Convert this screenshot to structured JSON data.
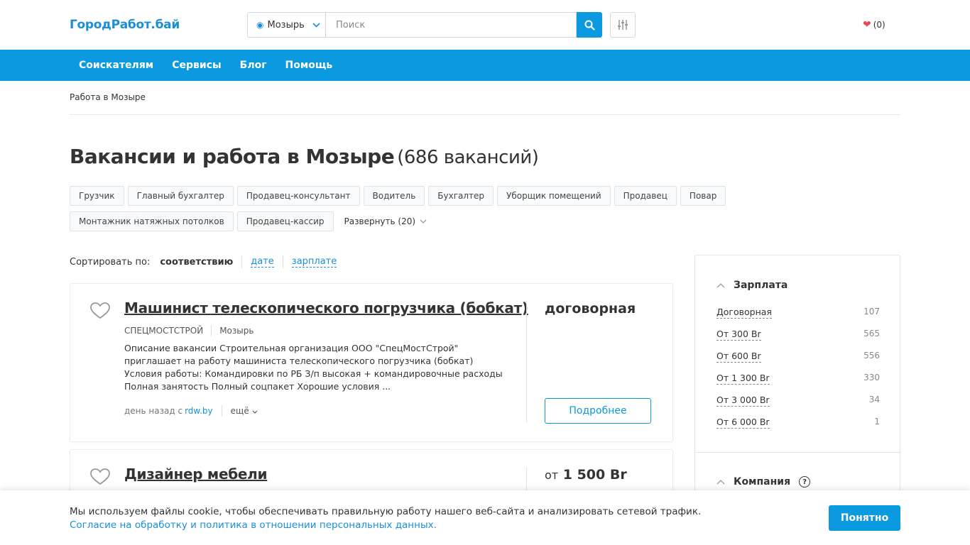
{
  "header": {
    "logo": "ГородРабот.бай",
    "city": "Мозырь",
    "search_placeholder": "Поиск",
    "favorites_count": "(0)"
  },
  "nav": {
    "items": [
      "Соискателям",
      "Сервисы",
      "Блог",
      "Помощь"
    ]
  },
  "breadcrumb": "Работа в Мозыре",
  "page": {
    "title": "Вакансии и работа в Мозыре",
    "count": "(686 вакансий)"
  },
  "tags": [
    "Грузчик",
    "Главный бухгалтер",
    "Продавец-консультант",
    "Водитель",
    "Бухгалтер",
    "Уборщик помещений",
    "Продавец",
    "Повар",
    "Монтажник натяжных потолков",
    "Продавец-кассир"
  ],
  "expand_label": "Развернуть (20)",
  "sort": {
    "label": "Сортировать по:",
    "active": "соответствию",
    "options": [
      "дате",
      "зарплате"
    ]
  },
  "vacancies": [
    {
      "title": "Машинист телескопического погрузчика (бобкат)",
      "company": "СПЕЦМОСТСТРОЙ",
      "city": "Мозырь",
      "description": "Описание вакансии Строительная организация ООО \"СпецМостСтрой\" приглашает на работу машиниста телескопического погрузчика (бобкат) Условия работы: Командировки по РБ З/п высокая + командировочные расходы Полная занятость Полный соцпакет Хорошие условия ...",
      "posted": "день назад с",
      "source": "rdw.by",
      "more": "ещё",
      "salary": "договорная",
      "button": "Подробнее"
    },
    {
      "title": "Дизайнер мебели",
      "salary_prefix": "от",
      "salary": "1 500 Br"
    }
  ],
  "sidebar": {
    "salary_heading": "Зарплата",
    "salary_items": [
      {
        "name": "Договорная",
        "count": "107"
      },
      {
        "name": "От 300 Br",
        "count": "565"
      },
      {
        "name": "От 600 Br",
        "count": "556"
      },
      {
        "name": "От 1 300 Br",
        "count": "330"
      },
      {
        "name": "От 3 000 Br",
        "count": "34"
      },
      {
        "name": "От 6 000 Br",
        "count": "1"
      }
    ],
    "company_heading": "Компания",
    "help_glyph": "?"
  },
  "cookie": {
    "text": "Мы используем файлы cookie, чтобы обеспечивать правильную работу нашего веб-сайта и анализировать сетевой трафик.",
    "link": "Согласие на обработку и политика в отношении персональных данных.",
    "button": "Понятно"
  },
  "colors": {
    "brand": "#0b9ae0",
    "link": "#1a8fd6",
    "heart": "#e54a5b"
  }
}
